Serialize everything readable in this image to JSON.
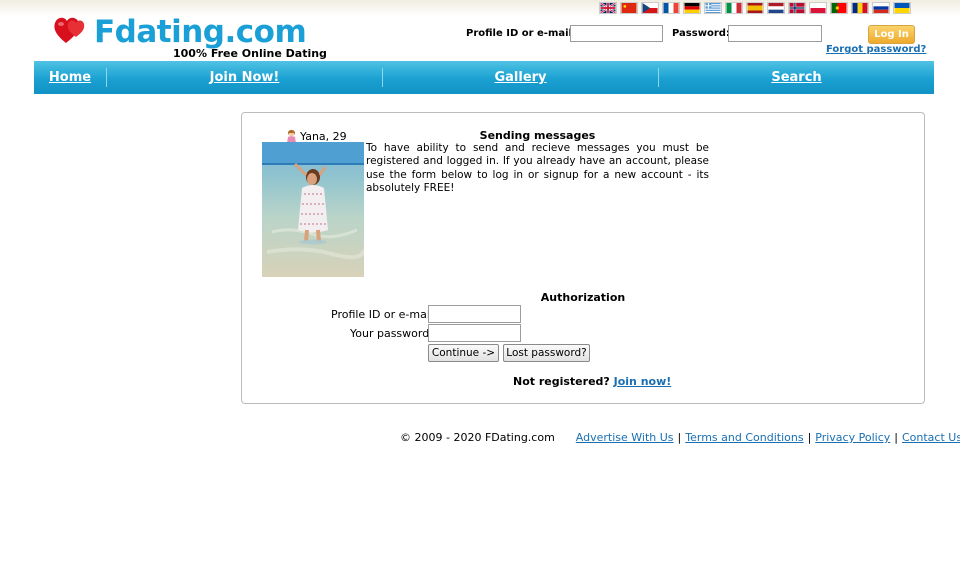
{
  "header": {
    "logo_text": "Fdating.com",
    "tagline": "100% Free Online Dating",
    "login_label": "Profile ID or e-mail:",
    "password_label": "Password:",
    "login_button": "Log In",
    "forgot_link": "Forgot password?",
    "flags": [
      "english",
      "chinese",
      "czech",
      "french",
      "german",
      "greek",
      "italian",
      "spanish",
      "dutch",
      "norwegian",
      "polish",
      "portuguese",
      "romanian",
      "russian",
      "ukrainian"
    ]
  },
  "nav": {
    "items": [
      "Home",
      "Join Now!",
      "Gallery",
      "Search"
    ]
  },
  "profile": {
    "name": "Yana, 29"
  },
  "message": {
    "title": "Sending messages",
    "body": "To have ability to send and recieve messages you must be registered and logged in. If you already have an account, please use the form below to log in or signup for a new account - its absolutely FREE!"
  },
  "auth": {
    "title": "Authorization",
    "login_label": "Profile ID or e-mail:",
    "password_label": "Your password:",
    "continue_button": "Continue ->",
    "lost_password_button": "Lost password?",
    "not_registered": "Not registered?",
    "join_link": "Join now!"
  },
  "footer": {
    "copyright": "© 2009 - 2020 FDating.com",
    "links": [
      "Advertise With Us",
      "Terms and Conditions",
      "Privacy Policy",
      "Contact Us"
    ]
  },
  "colors": {
    "brand": "#1aa0d6",
    "nav": "#1aa0d1",
    "link": "#1a6fb2",
    "login_button": "#eeaa2c"
  }
}
